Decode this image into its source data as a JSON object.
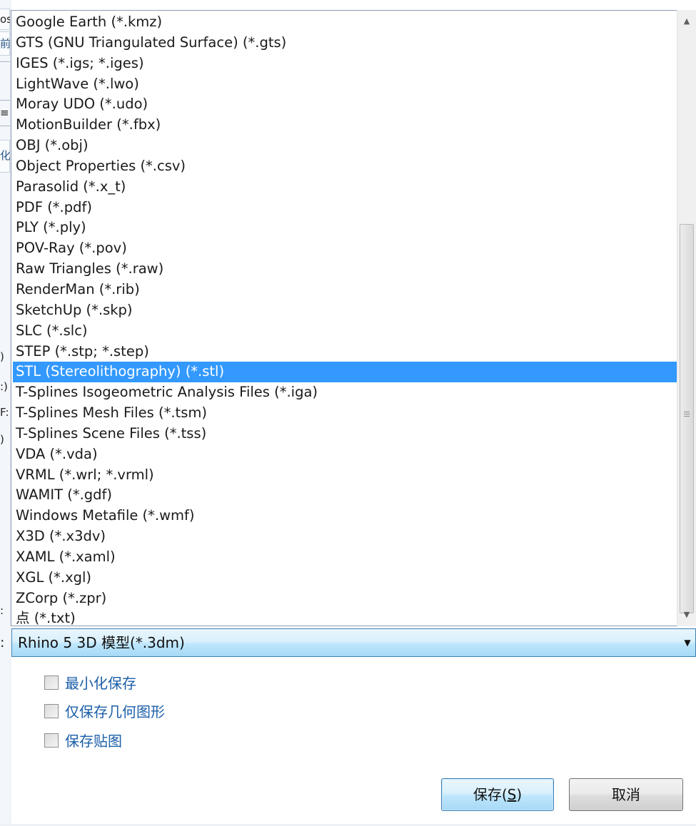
{
  "dropdown": {
    "items": [
      "Google Earth (*.kmz)",
      "GTS (GNU Triangulated Surface) (*.gts)",
      "IGES (*.igs; *.iges)",
      "LightWave (*.lwo)",
      "Moray UDO (*.udo)",
      "MotionBuilder (*.fbx)",
      "OBJ (*.obj)",
      "Object Properties (*.csv)",
      "Parasolid (*.x_t)",
      "PDF (*.pdf)",
      "PLY (*.ply)",
      "POV-Ray (*.pov)",
      "Raw Triangles (*.raw)",
      "RenderMan (*.rib)",
      "SketchUp (*.skp)",
      "SLC (*.slc)",
      "STEP (*.stp; *.step)",
      "STL (Stereolithography) (*.stl)",
      "T-Splines Isogeometric Analysis Files (*.iga)",
      "T-Splines Mesh Files (*.tsm)",
      "T-Splines Scene Files (*.tss)",
      "VDA (*.vda)",
      "VRML (*.wrl; *.vrml)",
      "WAMIT (*.gdf)",
      "Windows Metafile (*.wmf)",
      "X3D (*.x3dv)",
      "XAML (*.xaml)",
      "XGL (*.xgl)",
      "ZCorp (*.zpr)",
      "点 (*.txt)"
    ],
    "selected_index": 17
  },
  "file_type": {
    "value": "Rhino 5 3D 模型(*.3dm)",
    "colon": ":"
  },
  "options": [
    {
      "label": "最小化保存",
      "checked": false
    },
    {
      "label": "仅保存几何图形",
      "checked": false
    },
    {
      "label": "保存贴图",
      "checked": false
    }
  ],
  "buttons": {
    "save_label": "保存(",
    "save_accel": "S",
    "save_suffix": ")",
    "cancel_label": "取消"
  },
  "left_fragments": {
    "f1": "os",
    "f2": "前",
    "f3": "≡",
    "f4": "化",
    "f5": ")",
    "f6": ":)",
    "f7": "F:",
    "f8": ")",
    "f9": ":"
  },
  "colors": {
    "selection": "#3399ff",
    "option_label": "#1b5ea8",
    "accent_border": "#3c7fb1"
  },
  "icons": {
    "scroll_up": "triangle-up",
    "scroll_down": "triangle-down",
    "combo_arrow": "triangle-down",
    "thumb_grip": "three-lines"
  }
}
